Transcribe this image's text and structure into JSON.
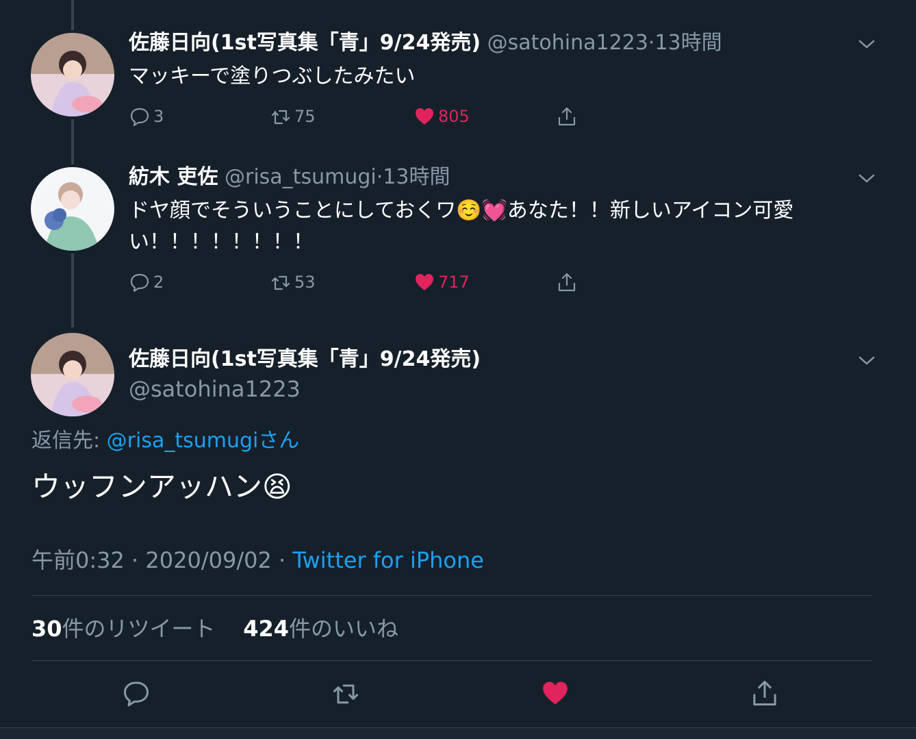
{
  "colors": {
    "background": "#15202b",
    "secondary_text": "#8899a6",
    "link": "#1da1f2",
    "like": "#e0245e",
    "divider": "#38444d"
  },
  "tweets": [
    {
      "name": "佐藤日向(1st写真集「青」9/24発売)",
      "handle": "@satohina1223",
      "separator": "·",
      "time": "13時間",
      "text": "マッキーで塗りつぶしたみたい",
      "replies": "3",
      "retweets": "75",
      "likes": "805"
    },
    {
      "name": "紡木 吏佐",
      "handle": "@risa_tsumugi",
      "separator": "·",
      "time": "13時間",
      "text_before": "ドヤ顔でそういうことにしておくワ",
      "emoji1": "☺️",
      "emoji2": "💓",
      "text_after": "あなた！！新しいアイコン可愛い！！！！！！！！",
      "replies": "2",
      "retweets": "53",
      "likes": "717"
    }
  ],
  "main": {
    "name": "佐藤日向(1st写真集「青」9/24発売)",
    "handle": "@satohina1223",
    "reply_prefix": "返信先: ",
    "reply_to": "@risa_tsumugi",
    "reply_suffix": "さん",
    "text": "ウッフンアッハン",
    "emoji": "😫",
    "time": "午前0:32",
    "sep1": " · ",
    "date": "2020/09/02",
    "sep2": " · ",
    "source": "Twitter for iPhone",
    "retweet_count": "30",
    "retweet_label": "件のリツイート",
    "like_count": "424",
    "like_label": "件のいいね"
  },
  "icons": {
    "reply": "reply-icon",
    "retweet": "retweet-icon",
    "like": "heart-icon",
    "share": "share-icon",
    "more": "chevron-down-icon"
  }
}
